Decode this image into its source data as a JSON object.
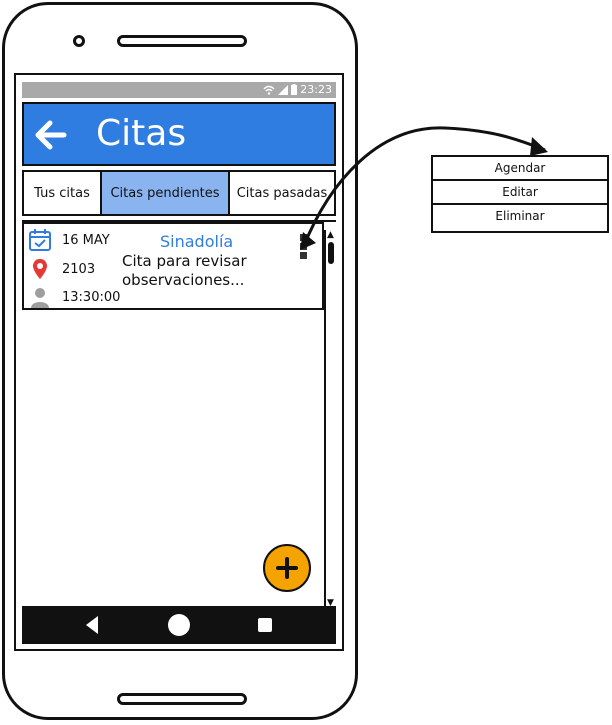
{
  "status_bar": {
    "time": "23:23"
  },
  "app_bar": {
    "title": "Citas",
    "back_icon": "back-arrow-icon",
    "color": "#2f7de1"
  },
  "tabs": [
    {
      "label": "Tus citas",
      "active": false
    },
    {
      "label": "Citas pendientes",
      "active": true
    },
    {
      "label": "Citas pasadas",
      "active": false
    }
  ],
  "appointment": {
    "date": "16 MAY",
    "location": "2103",
    "time": "13:30:00",
    "title": "Sinadolía",
    "description": "Cita para revisar observaciones..."
  },
  "context_menu": {
    "items": [
      "Agendar",
      "Editar",
      "Eliminar"
    ]
  },
  "fab": {
    "icon": "plus-icon",
    "color": "#f5a300"
  }
}
